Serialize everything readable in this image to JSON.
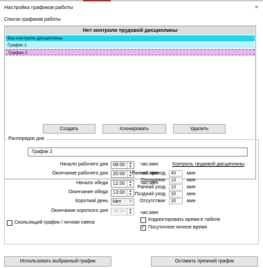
{
  "window": {
    "title": "Настройка графиков работы",
    "close": "×"
  },
  "list": {
    "section_label": "Список графиков работы",
    "header": "Нет контроля трудовой дисциплины",
    "items": [
      "Без контроля дисциплины",
      "График 1",
      "График 2"
    ],
    "selected": "График 2"
  },
  "list_buttons": {
    "create": "Создать",
    "clone": "Клонировать",
    "delete": "Удалить"
  },
  "schedule": {
    "legend": "Распорядок дня",
    "name": "График 2",
    "work_start_label": "Начало рабочего дня",
    "work_start": "08:00",
    "work_end_label": "Окончание рабочего дня",
    "work_end": "20:00",
    "lunch_start_label": "Начало обеда",
    "lunch_start": "12:00",
    "lunch_end_label": "Окончание обеда",
    "lunch_end": "13:00",
    "short_day_label": "Короткий день",
    "short_day": "Нет",
    "short_end_label": "Окончание короткого дня",
    "short_end": "16:00",
    "unit": "час:мин",
    "sliding_label": "Скользящий график / ночная смена",
    "sliding_checked": false
  },
  "control": {
    "title": "Контроль трудовой дисциплины",
    "rows": [
      {
        "label": "Ранний приход",
        "value": "40",
        "unit": "мин"
      },
      {
        "label": "Опоздание",
        "value": "10",
        "unit": "мин"
      },
      {
        "label": "Ранний уход",
        "value": "10",
        "unit": "мин"
      },
      {
        "label": "Поздний уход",
        "value": "30",
        "unit": "мин"
      },
      {
        "label": "Отсутствие",
        "value": "30",
        "unit": "мин"
      }
    ],
    "correct_label": "Корректировать время в табеле",
    "correct_checked": false,
    "hourly_label": "Посуточное ночное время",
    "hourly_checked": true,
    "check_mark": "✓"
  },
  "bottom_buttons": {
    "use": "Использовать выбранный график",
    "keep": "Оставить прежний график"
  }
}
